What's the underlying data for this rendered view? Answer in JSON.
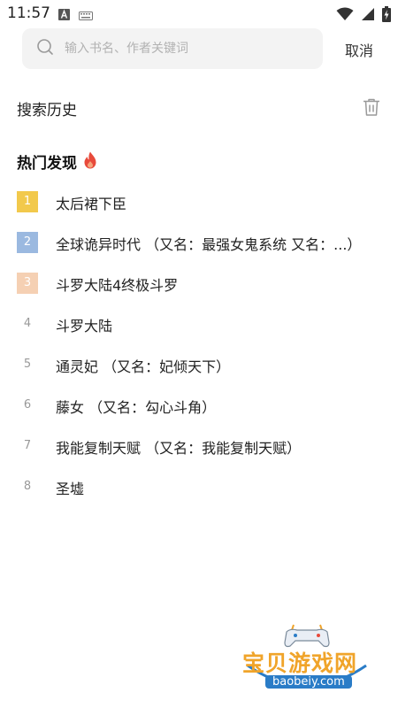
{
  "status_bar": {
    "time": "11:57",
    "icons": [
      "text-a-icon",
      "keyboard-icon",
      "wifi-icon",
      "signal-icon",
      "battery-charging-icon"
    ]
  },
  "search": {
    "placeholder": "输入书名、作者关键词",
    "value": "",
    "cancel_label": "取消"
  },
  "history": {
    "title": "搜索历史"
  },
  "hot": {
    "title": "热门发现",
    "items": [
      {
        "rank": "1",
        "title": "太后裙下臣"
      },
      {
        "rank": "2",
        "title": "全球诡异时代 （又名：最强女鬼系统 又名：...）"
      },
      {
        "rank": "3",
        "title": "斗罗大陆4终极斗罗"
      },
      {
        "rank": "4",
        "title": "斗罗大陆"
      },
      {
        "rank": "5",
        "title": "通灵妃 （又名：妃倾天下）"
      },
      {
        "rank": "6",
        "title": "藤女 （又名：勾心斗角）"
      },
      {
        "rank": "7",
        "title": "我能复制天赋 （又名：我能复制天赋）"
      },
      {
        "rank": "8",
        "title": "圣墟"
      }
    ]
  },
  "colors": {
    "rank1": "#f2c94c",
    "rank2": "#9bb9e0",
    "rank3": "#f5d0b3",
    "flame": "#e84a3b"
  },
  "watermark": {
    "name": "宝贝游戏网",
    "domain": "baobeiy.com"
  }
}
